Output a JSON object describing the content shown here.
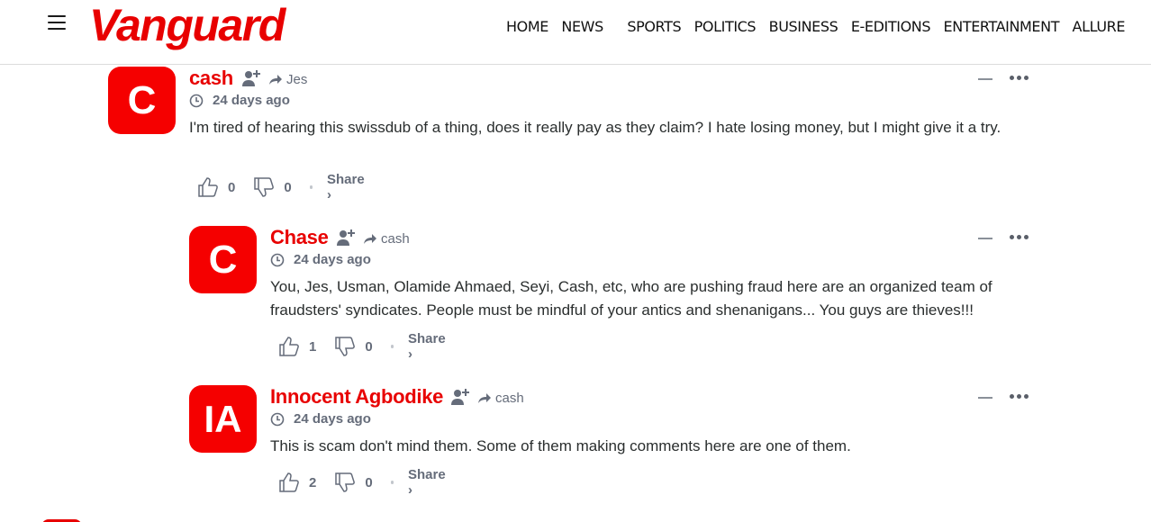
{
  "header": {
    "logo": "Vanguard",
    "nav": [
      "HOME",
      "NEWS",
      "SPORTS",
      "POLITICS",
      "BUSINESS",
      "E-EDITIONS",
      "ENTERTAINMENT",
      "ALLURE"
    ]
  },
  "comments": [
    {
      "initials": "C",
      "author": "cash",
      "reply_to": "Jes",
      "time": "24 days ago",
      "text": "I'm tired of hearing this swissdub of a thing, does it really pay as they claim? I hate losing money, but I might give it a try.",
      "upvotes": "0",
      "downvotes": "0",
      "share": "Share ›"
    },
    {
      "initials": "C",
      "author": "Chase",
      "reply_to": "cash",
      "time": "24 days ago",
      "text": "You, Jes, Usman, Olamide Ahmaed, Seyi, Cash, etc, who are pushing fraud here are an organized team of fraudsters' syndicates. People must be mindful of your antics and shenanigans... You guys are thieves!!!",
      "upvotes": "1",
      "downvotes": "0",
      "share": "Share ›"
    },
    {
      "initials": "IA",
      "author": "Innocent Agbodike",
      "reply_to": "cash",
      "time": "24 days ago",
      "text": "This is scam don't mind them. Some of them making comments here are one of them.",
      "upvotes": "2",
      "downvotes": "0",
      "share": "Share ›"
    }
  ],
  "colors": {
    "brand": "#e80000",
    "avatar": "#f50000",
    "meta": "#656c7a"
  }
}
